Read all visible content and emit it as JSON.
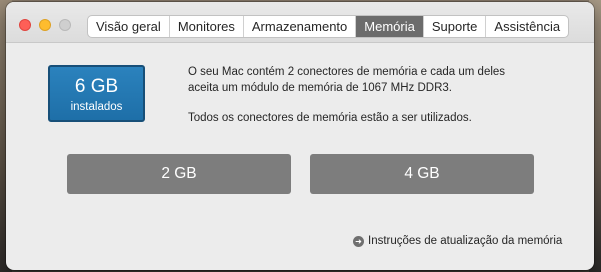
{
  "tabs": [
    {
      "label": "Visão geral",
      "active": false
    },
    {
      "label": "Monitores",
      "active": false
    },
    {
      "label": "Armazenamento",
      "active": false
    },
    {
      "label": "Memória",
      "active": true
    },
    {
      "label": "Suporte",
      "active": false
    },
    {
      "label": "Assistência",
      "active": false
    }
  ],
  "memory": {
    "total": "6 GB",
    "total_caption": "instalados",
    "description": "O seu Mac contém 2 conectores de memória e cada um deles aceita um módulo de memória de 1067 MHz DDR3.",
    "slots_status": "Todos os conectores de memória estão a ser utilizados.",
    "slots": [
      "2 GB",
      "4 GB"
    ]
  },
  "upgrade_link": {
    "label": "Instruções de atualização da memória",
    "icon": "arrow-circle-right-icon"
  },
  "colors": {
    "badge": "#1e6fa8",
    "active_tab": "#6c6c6c",
    "slot": "#7d7d7d"
  }
}
